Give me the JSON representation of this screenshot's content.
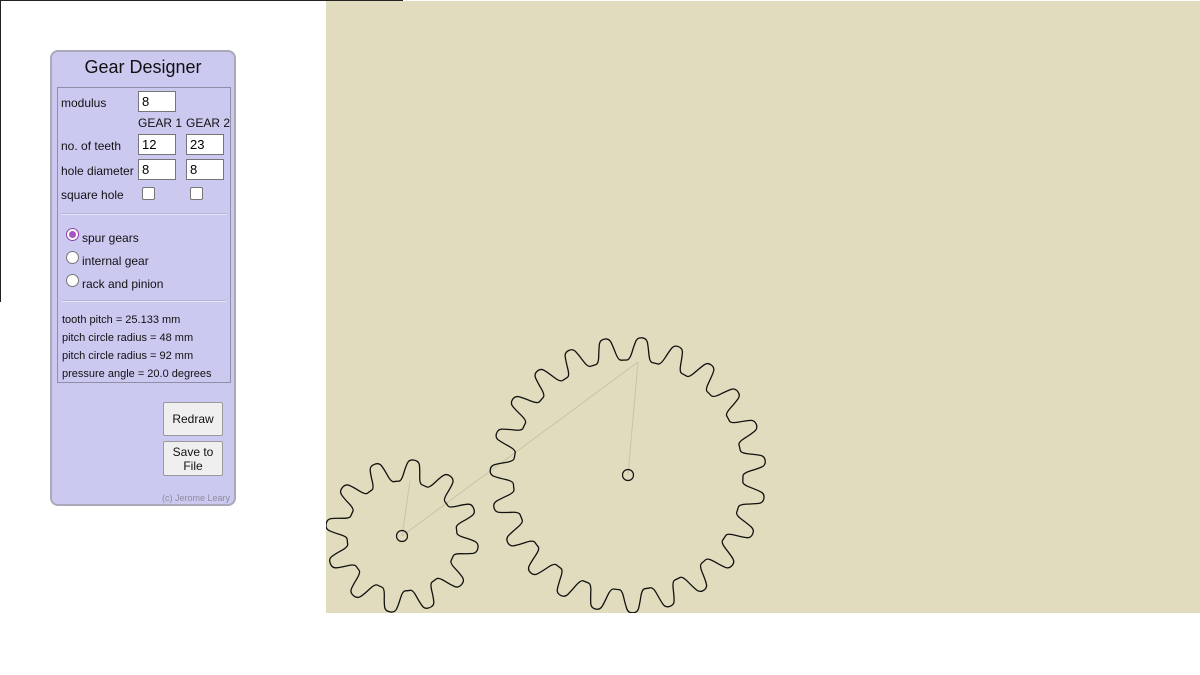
{
  "panel": {
    "title": "Gear Designer",
    "modulus": {
      "label": "modulus",
      "value": "8"
    },
    "gear1_header": "GEAR 1",
    "gear2_header": "GEAR 2",
    "teeth": {
      "label": "no. of teeth",
      "gear1": "12",
      "gear2": "23"
    },
    "hole": {
      "label": "hole diameter",
      "gear1": "8",
      "gear2": "8"
    },
    "square_hole": {
      "label": "square hole",
      "gear1_checked": false,
      "gear2_checked": false
    },
    "gear_types": [
      {
        "label": "spur gears",
        "selected": true
      },
      {
        "label": "internal gear",
        "selected": false
      },
      {
        "label": "rack and pinion",
        "selected": false
      }
    ],
    "stats": {
      "tooth_pitch": "tooth pitch = 25.133 mm",
      "pitch_radius_1": "pitch circle radius = 48 mm",
      "pitch_radius_2": "pitch circle radius = 92 mm",
      "pressure_angle": "pressure angle = 20.0 degrees"
    },
    "redraw_label": "Redraw",
    "save_label_line1": "Save to",
    "save_label_line2": "File",
    "credit": "(c) Jerome Leary"
  },
  "colors": {
    "canvas_bg": "#e1dcbd",
    "panel_bg": "#ccc9f1",
    "gear_outline": "#111111",
    "construction_line": "#c9c4a8",
    "radio_accent": "#a555bd"
  },
  "gears": {
    "gear1_teeth": 12,
    "gear2_teeth": 23
  }
}
